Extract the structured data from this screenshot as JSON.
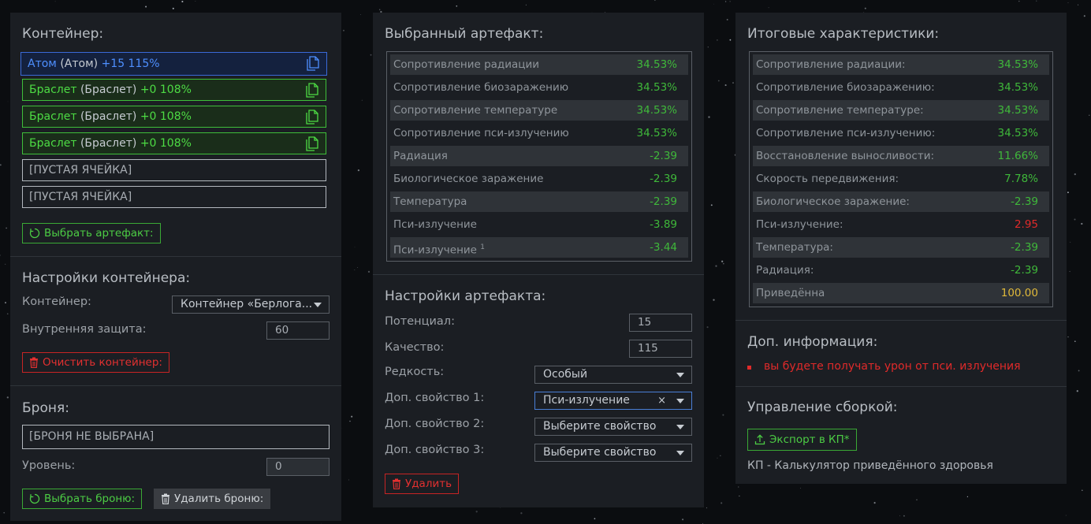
{
  "container_panel": {
    "title": "Контейнер:",
    "slots": [
      {
        "name": "Атом",
        "type": "(Атом)",
        "stats": "+15 115%",
        "kind": "atom"
      },
      {
        "name": "Браслет",
        "type": "(Браслет)",
        "stats": "+0 108%",
        "kind": "green"
      },
      {
        "name": "Браслет",
        "type": "(Браслет)",
        "stats": "+0 108%",
        "kind": "green"
      },
      {
        "name": "Браслет",
        "type": "(Браслет)",
        "stats": "+0 108%",
        "kind": "green"
      },
      {
        "name": "[ПУСТАЯ ЯЧЕЙКА]",
        "kind": "empty"
      },
      {
        "name": "[ПУСТАЯ ЯЧЕЙКА]",
        "kind": "empty"
      }
    ],
    "select_artifact_btn": "Выбрать артефакт:",
    "settings_title": "Настройки контейнера:",
    "container_label": "Контейнер:",
    "container_value": "Контейнер «Берлога»",
    "container_value_display": "Контейнер «Берлога...",
    "inner_protection_label": "Внутренняя защита:",
    "inner_protection_value": "60",
    "clear_btn": "Очистить контейнер:",
    "armor_title": "Броня:",
    "armor_value": "[БРОНЯ НЕ ВЫБРАНА]",
    "level_label": "Уровень:",
    "level_value": "0",
    "select_armor_btn": "Выбрать броню:",
    "delete_armor_btn": "Удалить броню:"
  },
  "artifact_panel": {
    "title": "Выбранный артефакт:",
    "stats": [
      {
        "key": "Сопротивление радиации",
        "value": "34.53%",
        "color": "green"
      },
      {
        "key": "Сопротивление биозаражению",
        "value": "34.53%",
        "color": "green"
      },
      {
        "key": "Сопротивление температуре",
        "value": "34.53%",
        "color": "green"
      },
      {
        "key": "Сопротивление пси-излучению",
        "value": "34.53%",
        "color": "green"
      },
      {
        "key": "Радиация",
        "value": "-2.39",
        "color": "green"
      },
      {
        "key": "Биологическое заражение",
        "value": "-2.39",
        "color": "green"
      },
      {
        "key": "Температура",
        "value": "-2.39",
        "color": "green"
      },
      {
        "key": "Пси-излучение",
        "value": "-3.89",
        "color": "green"
      },
      {
        "key": "Пси-излучение",
        "sup": "1",
        "value": "-3.44",
        "color": "green"
      }
    ],
    "settings_title": "Настройки артефакта:",
    "potential_label": "Потенциал:",
    "potential_value": "15",
    "quality_label": "Качество:",
    "quality_value": "115",
    "rarity_label": "Редкость:",
    "rarity_value": "Особый",
    "extra1_label": "Доп. свойство 1:",
    "extra1_value": "Пси-излучение",
    "extra1_clear": "×",
    "extra2_label": "Доп. свойство 2:",
    "extra2_value": "Выберите свойство",
    "extra3_label": "Доп. свойство 3:",
    "extra3_value": "Выберите свойство",
    "delete_btn": "Удалить"
  },
  "total_panel": {
    "title": "Итоговые характеристики:",
    "stats": [
      {
        "key": "Сопротивление радиации:",
        "value": "34.53%",
        "color": "green"
      },
      {
        "key": "Сопротивление биозаражению:",
        "value": "34.53%",
        "color": "green"
      },
      {
        "key": "Сопротивление температуре:",
        "value": "34.53%",
        "color": "green"
      },
      {
        "key": "Сопротивление пси-излучению:",
        "value": "34.53%",
        "color": "green"
      },
      {
        "key": "Восстановление выносливости:",
        "value": "11.66%",
        "color": "green"
      },
      {
        "key": "Скорость передвижения:",
        "value": "7.78%",
        "color": "green"
      },
      {
        "key": "Биологическое заражение:",
        "value": "-2.39",
        "color": "green"
      },
      {
        "key": "Пси-излучение:",
        "value": "2.95",
        "color": "red"
      },
      {
        "key": "Температура:",
        "value": "-2.39",
        "color": "green"
      },
      {
        "key": "Радиация:",
        "value": "-2.39",
        "color": "green"
      },
      {
        "key": "Приведённа",
        "value": "100.00",
        "color": "yellow"
      }
    ],
    "info_title": "Доп. информация:",
    "info_warning": "вы будете получать урон от пси. излучения",
    "build_title": "Управление сборкой:",
    "export_btn": "Экспорт в КП*",
    "footnote": "КП - Калькулятор приведённого здоровья"
  },
  "colors": {
    "green": "#3fb83a",
    "red": "#e02a2a",
    "yellow": "#e0b93a",
    "blue": "#4e8fff",
    "panel": "#1b1e23"
  }
}
